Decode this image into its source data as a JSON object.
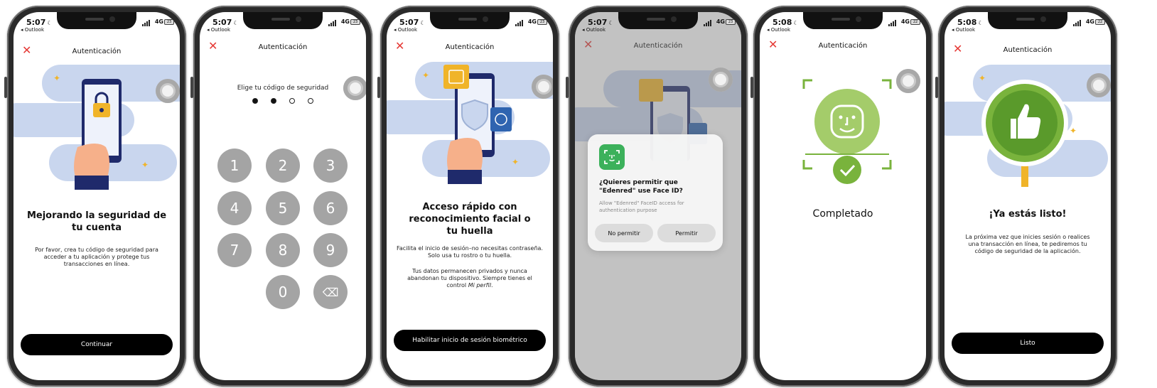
{
  "colors": {
    "accent_red": "#e53935",
    "illustration_blue": "#c9d6ee",
    "dark_navy": "#1f2a6b",
    "success_green": "#79b33c",
    "faceid_green": "#3cb15b",
    "key_gray": "#a4a4a4"
  },
  "common": {
    "back_app": "◂ Outlook",
    "network": "4G",
    "close_icon": "✕"
  },
  "screens": [
    {
      "time": "5:07",
      "battery": "23",
      "header": "Autenticación",
      "title": "Mejorando la seguridad de tu cuenta",
      "body": "Por favor, crea tu código de seguridad para acceder a tu aplicación y protege tus transacciones en línea.",
      "button": "Continuar"
    },
    {
      "time": "5:07",
      "battery": "23",
      "header": "Autenticación",
      "prompt": "Elige tu código de seguridad",
      "entered_digits": 2,
      "total_digits": 4,
      "keys": [
        "1",
        "2",
        "3",
        "4",
        "5",
        "6",
        "7",
        "8",
        "9",
        "0"
      ],
      "delete_icon": "⌫"
    },
    {
      "time": "5:07",
      "battery": "23",
      "header": "Autenticación",
      "title": "Acceso rápido con reconocimiento facial o tu huella",
      "body1": "Facilita el inicio de sesión–no necesitas contraseña. Solo usa tu rostro o tu huella.",
      "body2_prefix": "Tus datos permanecen privados y nunca abandonan tu dispositivo. Siempre tienes el control ",
      "body2_link": "Mi perfil",
      "body2_suffix": ".",
      "button": "Habilitar inicio de sesión biométrico"
    },
    {
      "time": "5:07",
      "battery": "23",
      "header": "Autenticación",
      "dialog_title": "¿Quieres permitir que \"Edenred\" use Face ID?",
      "dialog_message": "Allow \"Edenred\" FaceID access for authentication purpose",
      "deny": "No permitir",
      "allow": "Permitir"
    },
    {
      "time": "5:08",
      "battery": "22",
      "header": "Autenticación",
      "status": "Completado"
    },
    {
      "time": "5:08",
      "battery": "22",
      "header": "Autenticación",
      "title": "¡Ya estás listo!",
      "body": "La próxima vez que inicies sesión o realices una transacción en línea, te pediremos tu código de seguridad de la aplicación.",
      "button": "Listo"
    }
  ]
}
